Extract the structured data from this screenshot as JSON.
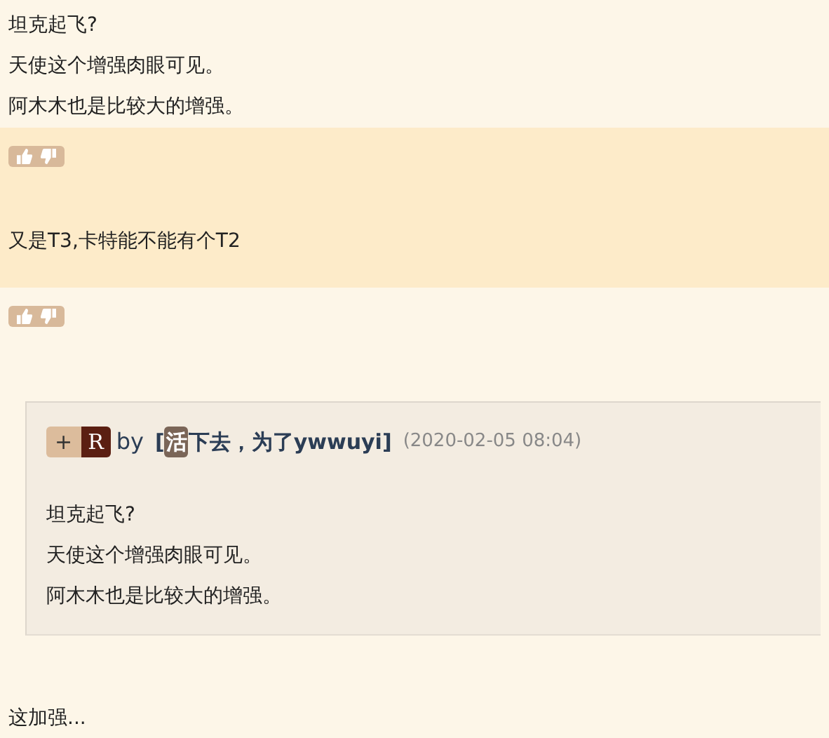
{
  "blocks": [
    {
      "kind": "text",
      "highlighted": false,
      "lines": [
        "坦克起飞?",
        "天使这个增强肉眼可见。",
        "阿木木也是比较大的增强。"
      ]
    },
    {
      "kind": "votes",
      "highlighted": true
    },
    {
      "kind": "text",
      "highlighted": true,
      "lines": [
        "又是T3,卡特能不能有个T2"
      ]
    },
    {
      "kind": "votes",
      "highlighted": false
    },
    {
      "kind": "quote",
      "tags": [
        "+",
        "R"
      ],
      "by": "by",
      "author": {
        "open": "[",
        "badge": "活",
        "name": "下去，为了ywwuyi",
        "close": "]"
      },
      "date": "(2020-02-05 08:04)",
      "lines": [
        "坦克起飞?",
        "天使这个增强肉眼可见。",
        "阿木木也是比较大的增强。"
      ]
    },
    {
      "kind": "text",
      "highlighted": false,
      "lines": [
        "这加强..."
      ]
    }
  ]
}
